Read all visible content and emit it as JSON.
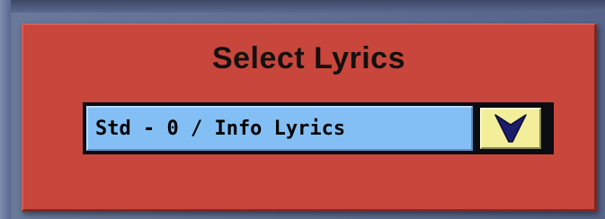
{
  "panel": {
    "title": "Select Lyrics",
    "colors": {
      "panel_bg": "#c8463b",
      "field_bg": "#83bff4",
      "button_bg": "#f2ee9a",
      "arrow": "#1b1d6a"
    }
  },
  "lyrics_select": {
    "selected_value": "Std - 0 / Info Lyrics",
    "button_icon": "chevron-down-icon"
  }
}
